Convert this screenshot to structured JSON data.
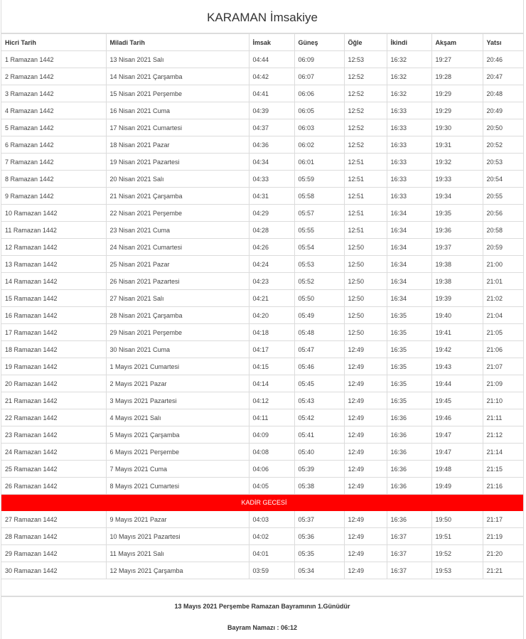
{
  "page": {
    "title": "KARAMAN İmsakiye"
  },
  "columns": [
    "Hicri Tarih",
    "Miladi Tarih",
    "İmsak",
    "Güneş",
    "Öğle",
    "İkindi",
    "Akşam",
    "Yatsı"
  ],
  "rows_before": [
    [
      "1 Ramazan 1442",
      "13 Nisan 2021 Salı",
      "04:44",
      "06:09",
      "12:53",
      "16:32",
      "19:27",
      "20:46"
    ],
    [
      "2 Ramazan 1442",
      "14 Nisan 2021 Çarşamba",
      "04:42",
      "06:07",
      "12:52",
      "16:32",
      "19:28",
      "20:47"
    ],
    [
      "3 Ramazan 1442",
      "15 Nisan 2021 Perşembe",
      "04:41",
      "06:06",
      "12:52",
      "16:32",
      "19:29",
      "20:48"
    ],
    [
      "4 Ramazan 1442",
      "16 Nisan 2021 Cuma",
      "04:39",
      "06:05",
      "12:52",
      "16:33",
      "19:29",
      "20:49"
    ],
    [
      "5 Ramazan 1442",
      "17 Nisan 2021 Cumartesi",
      "04:37",
      "06:03",
      "12:52",
      "16:33",
      "19:30",
      "20:50"
    ],
    [
      "6 Ramazan 1442",
      "18 Nisan 2021 Pazar",
      "04:36",
      "06:02",
      "12:52",
      "16:33",
      "19:31",
      "20:52"
    ],
    [
      "7 Ramazan 1442",
      "19 Nisan 2021 Pazartesi",
      "04:34",
      "06:01",
      "12:51",
      "16:33",
      "19:32",
      "20:53"
    ],
    [
      "8 Ramazan 1442",
      "20 Nisan 2021 Salı",
      "04:33",
      "05:59",
      "12:51",
      "16:33",
      "19:33",
      "20:54"
    ],
    [
      "9 Ramazan 1442",
      "21 Nisan 2021 Çarşamba",
      "04:31",
      "05:58",
      "12:51",
      "16:33",
      "19:34",
      "20:55"
    ],
    [
      "10 Ramazan 1442",
      "22 Nisan 2021 Perşembe",
      "04:29",
      "05:57",
      "12:51",
      "16:34",
      "19:35",
      "20:56"
    ],
    [
      "11 Ramazan 1442",
      "23 Nisan 2021 Cuma",
      "04:28",
      "05:55",
      "12:51",
      "16:34",
      "19:36",
      "20:58"
    ],
    [
      "12 Ramazan 1442",
      "24 Nisan 2021 Cumartesi",
      "04:26",
      "05:54",
      "12:50",
      "16:34",
      "19:37",
      "20:59"
    ],
    [
      "13 Ramazan 1442",
      "25 Nisan 2021 Pazar",
      "04:24",
      "05:53",
      "12:50",
      "16:34",
      "19:38",
      "21:00"
    ],
    [
      "14 Ramazan 1442",
      "26 Nisan 2021 Pazartesi",
      "04:23",
      "05:52",
      "12:50",
      "16:34",
      "19:38",
      "21:01"
    ],
    [
      "15 Ramazan 1442",
      "27 Nisan 2021 Salı",
      "04:21",
      "05:50",
      "12:50",
      "16:34",
      "19:39",
      "21:02"
    ],
    [
      "16 Ramazan 1442",
      "28 Nisan 2021 Çarşamba",
      "04:20",
      "05:49",
      "12:50",
      "16:35",
      "19:40",
      "21:04"
    ],
    [
      "17 Ramazan 1442",
      "29 Nisan 2021 Perşembe",
      "04:18",
      "05:48",
      "12:50",
      "16:35",
      "19:41",
      "21:05"
    ],
    [
      "18 Ramazan 1442",
      "30 Nisan 2021 Cuma",
      "04:17",
      "05:47",
      "12:49",
      "16:35",
      "19:42",
      "21:06"
    ],
    [
      "19 Ramazan 1442",
      "1 Mayıs 2021 Cumartesi",
      "04:15",
      "05:46",
      "12:49",
      "16:35",
      "19:43",
      "21:07"
    ],
    [
      "20 Ramazan 1442",
      "2 Mayıs 2021 Pazar",
      "04:14",
      "05:45",
      "12:49",
      "16:35",
      "19:44",
      "21:09"
    ],
    [
      "21 Ramazan 1442",
      "3 Mayıs 2021 Pazartesi",
      "04:12",
      "05:43",
      "12:49",
      "16:35",
      "19:45",
      "21:10"
    ],
    [
      "22 Ramazan 1442",
      "4 Mayıs 2021 Salı",
      "04:11",
      "05:42",
      "12:49",
      "16:36",
      "19:46",
      "21:11"
    ],
    [
      "23 Ramazan 1442",
      "5 Mayıs 2021 Çarşamba",
      "04:09",
      "05:41",
      "12:49",
      "16:36",
      "19:47",
      "21:12"
    ],
    [
      "24 Ramazan 1442",
      "6 Mayıs 2021 Perşembe",
      "04:08",
      "05:40",
      "12:49",
      "16:36",
      "19:47",
      "21:14"
    ],
    [
      "25 Ramazan 1442",
      "7 Mayıs 2021 Cuma",
      "04:06",
      "05:39",
      "12:49",
      "16:36",
      "19:48",
      "21:15"
    ],
    [
      "26 Ramazan 1442",
      "8 Mayıs 2021 Cumartesi",
      "04:05",
      "05:38",
      "12:49",
      "16:36",
      "19:49",
      "21:16"
    ]
  ],
  "special_row": {
    "label": "KADİR GECESİ",
    "color": "#ff0000"
  },
  "rows_after": [
    [
      "27 Ramazan 1442",
      "9 Mayıs 2021 Pazar",
      "04:03",
      "05:37",
      "12:49",
      "16:36",
      "19:50",
      "21:17"
    ],
    [
      "28 Ramazan 1442",
      "10 Mayıs 2021 Pazartesi",
      "04:02",
      "05:36",
      "12:49",
      "16:37",
      "19:51",
      "21:19"
    ],
    [
      "29 Ramazan 1442",
      "11 Mayıs 2021 Salı",
      "04:01",
      "05:35",
      "12:49",
      "16:37",
      "19:52",
      "21:20"
    ],
    [
      "30 Ramazan 1442",
      "12 Mayıs 2021 Çarşamba",
      "03:59",
      "05:34",
      "12:49",
      "16:37",
      "19:53",
      "21:21"
    ]
  ],
  "footer": {
    "line1": "13 Mayıs 2021 Perşembe Ramazan Bayramının 1.Günüdür",
    "line2": "Bayram Namazı : 06:12"
  }
}
